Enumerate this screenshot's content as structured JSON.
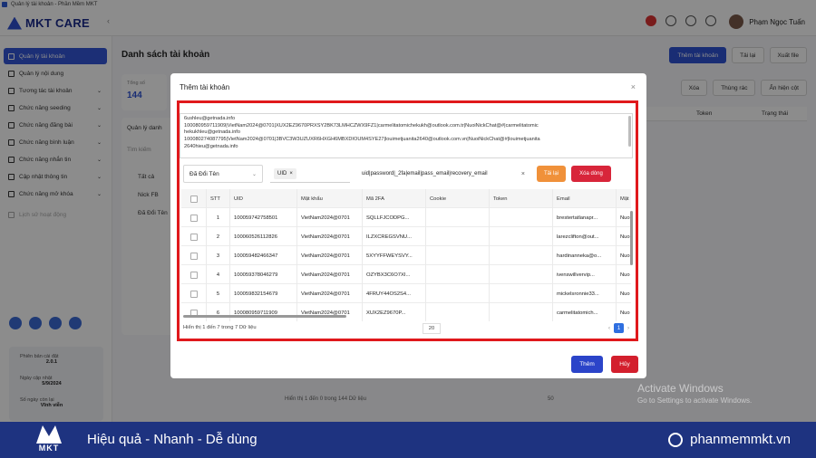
{
  "window": {
    "title": "Quản lý tài khoản - Phần Mềm MKT"
  },
  "header": {
    "brand": "MKT CARE",
    "user_name": "Phạm Ngọc Tuấn"
  },
  "sidebar": {
    "items": [
      {
        "label": "Quản lý tài khoản",
        "active": true
      },
      {
        "label": "Quản lý nội dung"
      },
      {
        "label": "Tương tác tài khoản"
      },
      {
        "label": "Chức năng seeding"
      },
      {
        "label": "Chức năng đăng bài"
      },
      {
        "label": "Chức năng bình luận"
      },
      {
        "label": "Chức năng nhắn tin"
      },
      {
        "label": "Cập nhật thông tin"
      },
      {
        "label": "Chức năng mở khóa"
      },
      {
        "label": "Lịch sử hoạt động"
      }
    ],
    "version_label": "Phiên bản cài đặt",
    "version": "2.0.1",
    "expiry_label": "Ngày cập nhật",
    "expiry": "5/9/2024",
    "days_label": "Số ngày còn lại",
    "days": "Vĩnh viễn"
  },
  "main": {
    "page_title": "Danh sách tài khoản",
    "btn_add_account": "Thêm tài khoản",
    "btn_reload": "Tải lại",
    "btn_export": "Xuất file",
    "stat_label": "Tổng số",
    "stat_value": "144",
    "left_panel_title": "Quản lý danh",
    "left_search": "Tìm kiếm",
    "left_items": [
      "Tất cả",
      "Nick FB",
      "Đã Đổi Tên"
    ],
    "btn_delete": "Xóa",
    "btn_trash": "Thùng rác",
    "btn_show_cols": "Ẩn hiện cột",
    "col_token": "Token",
    "col_status": "Trạng thái",
    "footer_text": "Hiển thị 1 đến 0 trong 144 Dữ liệu",
    "footer_pagesize": "50"
  },
  "modal": {
    "title": "Thêm tài khoản",
    "textarea_lines": [
      "6ushleu@getnada.info",
      "100080959711909|VietNam2024@0701|XUX2EZ9670PRXSY2BK73LMHCZWX9FZ1|carmelitatomichekukh@outlook.com.tr|NuoiNickChat@#|carmelitatomic",
      "hekukhleu@getnada.info",
      "100080274087795|VietNam2024@0701|3BVC3W3UZUXR6HXGH6MBXDIOUM4SYE27|louimetjuanita2640@outlook.com.vn|NuoiNickChat@#|louimetjuanita",
      "2640hieu@getnada.info"
    ],
    "folder_select": "Đã Đổi Tên",
    "uid_tag": "UID",
    "format_text": "uid|password|_2fa|email|pass_email|recovery_email",
    "btn_reload": "Tải lại",
    "btn_delete_row": "Xóa dòng",
    "columns": [
      "",
      "STT",
      "UID",
      "Mật khẩu",
      "Mã 2FA",
      "Cookie",
      "Token",
      "Email",
      "Mật"
    ],
    "rows": [
      {
        "stt": "1",
        "uid": "100059742758501",
        "password": "VietNam2024@0701",
        "twofa": "SQLLFJCODPG...",
        "cookie": "",
        "token": "",
        "email": "brestertatlanapr...",
        "mat": "Nuo"
      },
      {
        "stt": "2",
        "uid": "100060526112826",
        "password": "VietNam2024@0701",
        "twofa": "ILZXCREGSVNU...",
        "cookie": "",
        "token": "",
        "email": "larezclifton@out...",
        "mat": "Nuo"
      },
      {
        "stt": "3",
        "uid": "100059482466347",
        "password": "VietNam2024@0701",
        "twofa": "5XYYFFWEYSVY...",
        "cookie": "",
        "token": "",
        "email": "hardinanneka@o...",
        "mat": "Nuo"
      },
      {
        "stt": "4",
        "uid": "100059378046279",
        "password": "VietNam2024@0701",
        "twofa": "OZYBX3C6O7XI...",
        "cookie": "",
        "token": "",
        "email": "ivenswillvervip...",
        "mat": "Nuo"
      },
      {
        "stt": "5",
        "uid": "100059832154679",
        "password": "VietNam2024@0701",
        "twofa": "4FRUY44OS2S4...",
        "cookie": "",
        "token": "",
        "email": "mickelsronnie33...",
        "mat": "Nuo"
      },
      {
        "stt": "6",
        "uid": "100080959711909",
        "password": "VietNam2024@0701",
        "twofa": "XUX2EZ9670P...",
        "cookie": "",
        "token": "",
        "email": "carmelitatomich...",
        "mat": "Nuo"
      }
    ],
    "footer_text": "Hiển thị 1 đến 7 trong 7 Dữ liệu",
    "page_size": "20",
    "current_page": "1",
    "btn_add": "Thêm",
    "btn_cancel": "Hủy"
  },
  "os_watermark": {
    "line1": "Activate Windows",
    "line2": "Go to Settings to activate Windows."
  },
  "banner": {
    "logo_text": "MKT",
    "slogan": "Hiệu quả - Nhanh - Dễ dùng",
    "website": "phanmemmkt.vn"
  },
  "colors": {
    "primary": "#2f53d4",
    "danger": "#d8253a",
    "warning": "#f0913a",
    "banner": "#1e3380",
    "highlight_frame": "#e0191c"
  }
}
